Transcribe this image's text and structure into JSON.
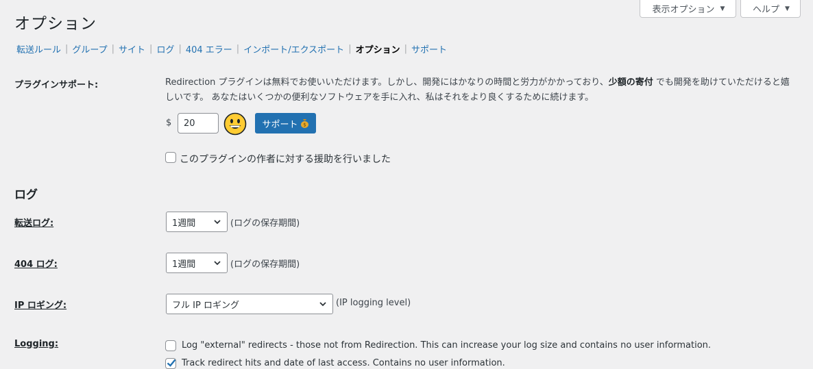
{
  "screen_meta": {
    "screen_options_label": "表示オプション",
    "help_label": "ヘルプ"
  },
  "page_title": "オプション",
  "nav": {
    "items": [
      {
        "label": "転送ルール"
      },
      {
        "label": "グループ"
      },
      {
        "label": "サイト"
      },
      {
        "label": "ログ"
      },
      {
        "label": "404 エラー"
      },
      {
        "label": "インポート/エクスポート"
      },
      {
        "label": "オプション"
      },
      {
        "label": "サポート"
      }
    ],
    "current_index": 6
  },
  "plugin_support": {
    "label": "プラグインサポート:",
    "description_part1": "Redirection プラグインは無料でお使いいただけます。しかし、開発にはかなりの時間と労力がかかっており、",
    "description_bold": "少額の寄付",
    "description_part2": " でも開発を助けていただけると嬉しいです。 あなたはいくつかの便利なソフトウェアを手に入れ、私はそれをより良くするために続けます。",
    "currency": "$",
    "amount": "20",
    "support_button_label": "サポート",
    "supported_checkbox_label": "このプラグインの作者に対する援助を行いました",
    "supported_checked": false
  },
  "logs_section": {
    "heading": "ログ",
    "redirect_log": {
      "label": "転送ログ:",
      "value": "1週間",
      "hint": "(ログの保存期間)"
    },
    "log_404": {
      "label": "404 ログ:",
      "value": "1週間",
      "hint": "(ログの保存期間)"
    },
    "ip_logging": {
      "label": "IP ロギング:",
      "value": "フル IP ロギング",
      "hint": "(IP logging level)"
    },
    "logging": {
      "label": "Logging:",
      "options": [
        {
          "label": "Log \"external\" redirects - those not from Redirection. This can increase your log size and contains no user information.",
          "checked": false
        },
        {
          "label": "Track redirect hits and date of last access. Contains no user information.",
          "checked": true
        }
      ]
    }
  },
  "colors": {
    "accent": "#2271b1",
    "background": "#f0f0f1",
    "text": "#1d2327",
    "smiley": "#ffcc33"
  }
}
